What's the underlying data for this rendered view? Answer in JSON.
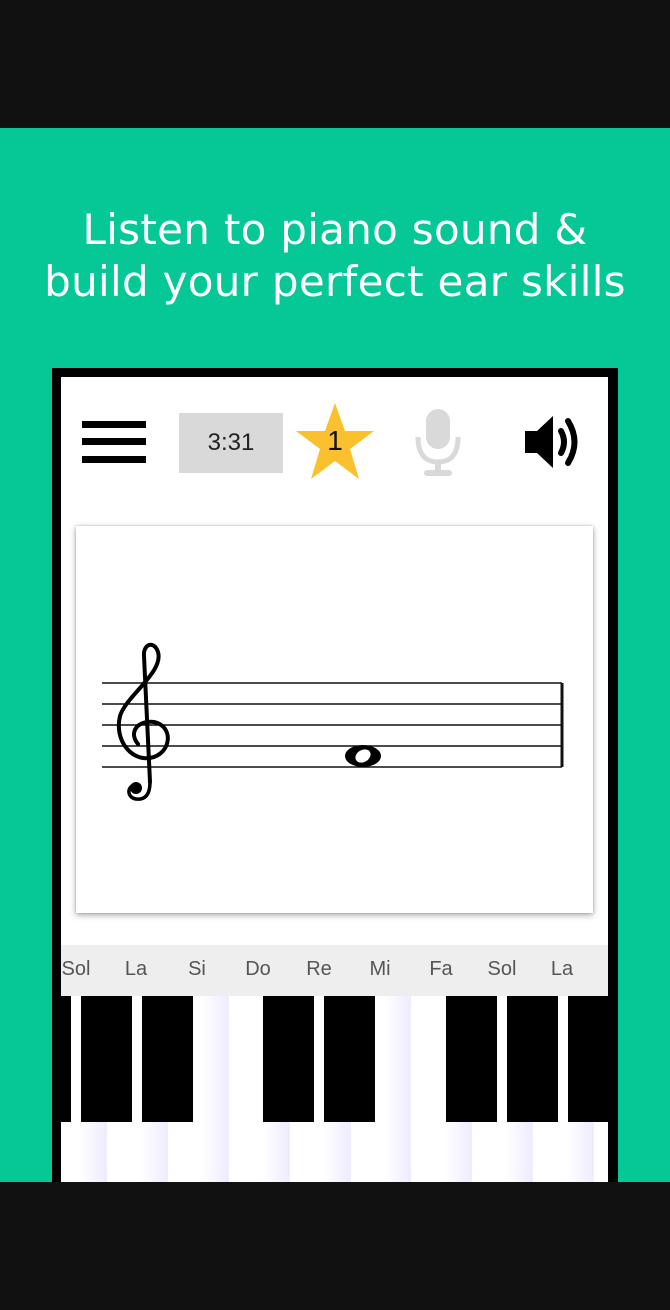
{
  "promo": {
    "headline_line1": "Listen to piano sound &",
    "headline_line2": "build your perfect ear skills",
    "background_color": "#06c896"
  },
  "toolbar": {
    "menu_icon": "hamburger-menu-icon",
    "timer": "3:31",
    "star_count": "1",
    "star_color": "#fbc02d",
    "mic_icon": "microphone-icon",
    "mic_state": "disabled",
    "speaker_icon": "speaker-volume-icon"
  },
  "staff": {
    "clef": "treble-clef",
    "note": "whole-note",
    "note_pitch_label": "Mi"
  },
  "note_labels": [
    "Sol",
    "La",
    "Si",
    "Do",
    "Re",
    "Mi",
    "Fa",
    "Sol",
    "La"
  ]
}
